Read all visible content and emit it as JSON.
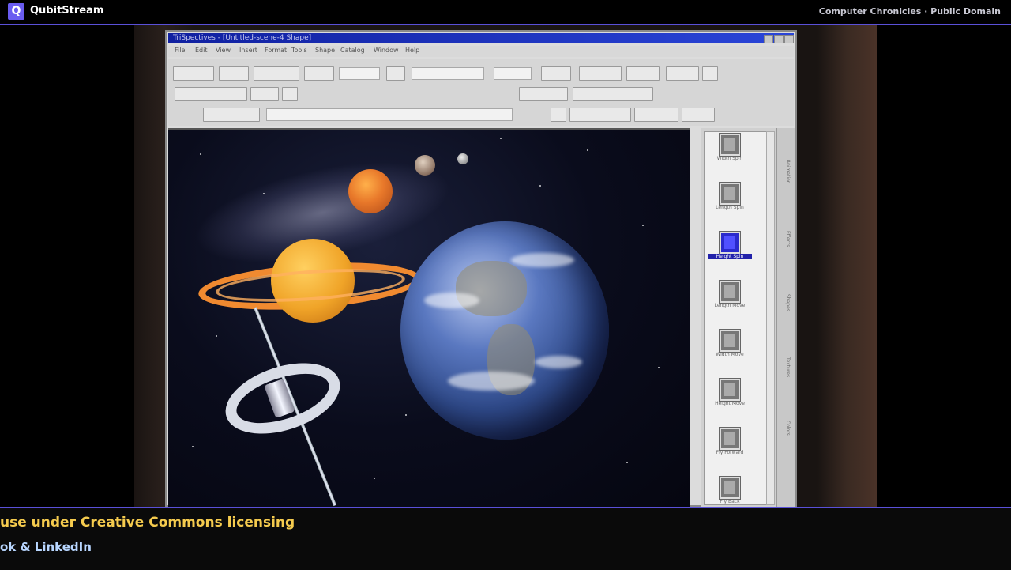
{
  "header": {
    "logo_letter": "Q",
    "brand": "QubitStream",
    "credit": "Computer Chronicles · Public Domain"
  },
  "app_window": {
    "title": "TriSpectives - [Untitled-scene-4 Shape]",
    "menus": [
      "File",
      "Edit",
      "View",
      "Insert",
      "Format",
      "Tools",
      "Shape",
      "Catalog",
      "Window",
      "Help"
    ]
  },
  "clip_catalog": {
    "items": [
      {
        "label": "Width Spin",
        "selected": false
      },
      {
        "label": "Length Spin",
        "selected": false
      },
      {
        "label": "Height Spin",
        "selected": true
      },
      {
        "label": "Length Move",
        "selected": false
      },
      {
        "label": "Width Move",
        "selected": false
      },
      {
        "label": "Height Move",
        "selected": false
      },
      {
        "label": "Fly Forward",
        "selected": false
      },
      {
        "label": "Fly Back",
        "selected": false
      }
    ],
    "tabs": [
      "Animation",
      "Effects",
      "Shapes",
      "Textures",
      "Colors"
    ]
  },
  "ticker": {
    "line1": "use under Creative Commons licensing",
    "line2": "ok & LinkedIn"
  }
}
